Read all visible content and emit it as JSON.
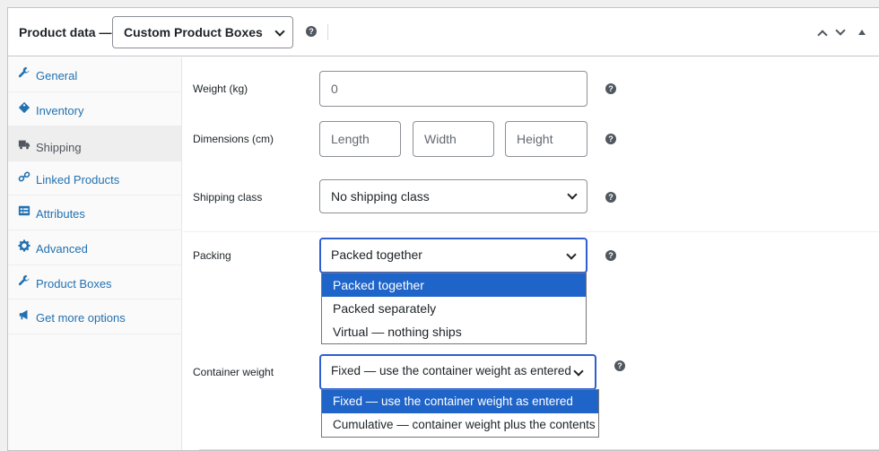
{
  "header": {
    "label": "Product data —",
    "product_type": "Custom Product Boxes"
  },
  "sidebar": {
    "items": [
      {
        "label": "General",
        "icon": "wrench-icon"
      },
      {
        "label": "Inventory",
        "icon": "tag-icon"
      },
      {
        "label": "Shipping",
        "icon": "truck-icon",
        "active": true
      },
      {
        "label": "Linked Products",
        "icon": "link-icon"
      },
      {
        "label": "Attributes",
        "icon": "list-icon"
      },
      {
        "label": "Advanced",
        "icon": "gear-icon"
      },
      {
        "label": "Product Boxes",
        "icon": "wrench-icon"
      },
      {
        "label": "Get more options",
        "icon": "megaphone-icon"
      }
    ]
  },
  "shipping": {
    "weight": {
      "label": "Weight (kg)",
      "placeholder": "0"
    },
    "dimensions": {
      "label": "Dimensions (cm)",
      "length_placeholder": "Length",
      "width_placeholder": "Width",
      "height_placeholder": "Height"
    },
    "shipping_class": {
      "label": "Shipping class",
      "value": "No shipping class"
    },
    "packing": {
      "label": "Packing",
      "value": "Packed together",
      "options": [
        "Packed together",
        "Packed separately",
        "Virtual — nothing ships"
      ]
    },
    "container_weight": {
      "label": "Container weight",
      "value": "Fixed — use the container weight as entered",
      "options": [
        "Fixed — use the container weight as entered",
        "Cumulative — container weight plus the contents"
      ]
    }
  },
  "help_glyph": "?",
  "colors": {
    "link": "#2271b1",
    "focus": "#2f5fd0",
    "selected_option": "#1f64c8"
  }
}
